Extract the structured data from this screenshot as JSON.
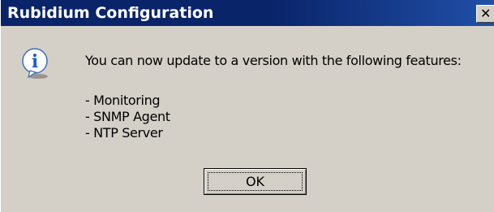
{
  "window": {
    "title": "Rubidium Configuration",
    "close_glyph": "✕"
  },
  "icon": {
    "name": "information-icon",
    "glyph": "i",
    "color": "#1f5fc4"
  },
  "message": "You can now update to a version with the following features:",
  "features": [
    "- Monitoring",
    "- SNMP Agent",
    "- NTP Server"
  ],
  "buttons": {
    "ok_label": "OK"
  },
  "colors": {
    "titlebar": "#0a246a",
    "titlebar_text": "#ffffff",
    "dialog_face": "#d4d0c8"
  }
}
